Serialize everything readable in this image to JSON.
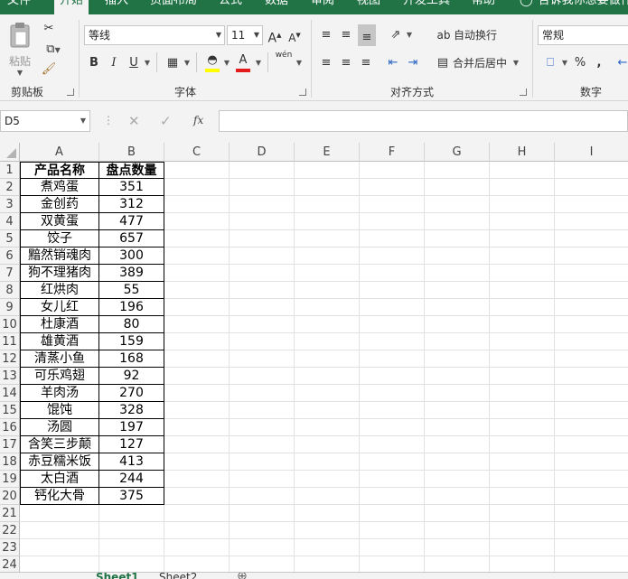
{
  "ribbon": {
    "tabs": [
      "文件",
      "开始",
      "插入",
      "页面布局",
      "公式",
      "数据",
      "审阅",
      "视图",
      "开发工具",
      "帮助"
    ],
    "active_tab": "开始",
    "tell_me": "告诉我你想要做什么",
    "clipboard": {
      "paste_label": "粘贴",
      "group_label": "剪贴板"
    },
    "font": {
      "name": "等线",
      "size": "11",
      "group_label": "字体",
      "bold": "B",
      "italic": "I",
      "underline": "U",
      "grow": "A",
      "shrink": "A",
      "phonetic": "wén",
      "font_color_letter": "A"
    },
    "alignment": {
      "wrap_text": "自动换行",
      "merge_center": "合并后居中",
      "group_label": "对齐方式"
    },
    "number": {
      "format": "常规",
      "group_label": "数字",
      "percent": "%",
      "comma": ","
    }
  },
  "formula_bar": {
    "name_box": "D5",
    "fx": "fx",
    "value": ""
  },
  "columns": [
    "A",
    "B",
    "C",
    "D",
    "E",
    "F",
    "G",
    "H",
    "I"
  ],
  "rows": [
    "1",
    "2",
    "3",
    "4",
    "5",
    "6",
    "7",
    "8",
    "9",
    "10",
    "11",
    "12",
    "13",
    "14",
    "15",
    "16",
    "17",
    "18",
    "19",
    "20",
    "21",
    "22",
    "23",
    "24"
  ],
  "table": {
    "headers": [
      "产品名称",
      "盘点数量"
    ],
    "rows": [
      [
        "煮鸡蛋",
        "351"
      ],
      [
        "金创药",
        "312"
      ],
      [
        "双黄蛋",
        "477"
      ],
      [
        "饺子",
        "657"
      ],
      [
        "黯然销魂肉",
        "300"
      ],
      [
        "狗不理猪肉",
        "389"
      ],
      [
        "红烘肉",
        "55"
      ],
      [
        "女儿红",
        "196"
      ],
      [
        "杜康酒",
        "80"
      ],
      [
        "雄黄酒",
        "159"
      ],
      [
        "清蒸小鱼",
        "168"
      ],
      [
        "可乐鸡翅",
        "92"
      ],
      [
        "羊肉汤",
        "270"
      ],
      [
        "馄饨",
        "328"
      ],
      [
        "汤圆",
        "197"
      ],
      [
        "含笑三步颠",
        "127"
      ],
      [
        "赤豆糯米饭",
        "413"
      ],
      [
        "太白酒",
        "244"
      ],
      [
        "钙化大骨",
        "375"
      ]
    ]
  },
  "sheet_tabs": [
    "Sheet1",
    "Sheet2"
  ],
  "colors": {
    "accent": "#217346",
    "font_color_bar": "#e31b1b",
    "highlight_bar": "#ffff00"
  }
}
